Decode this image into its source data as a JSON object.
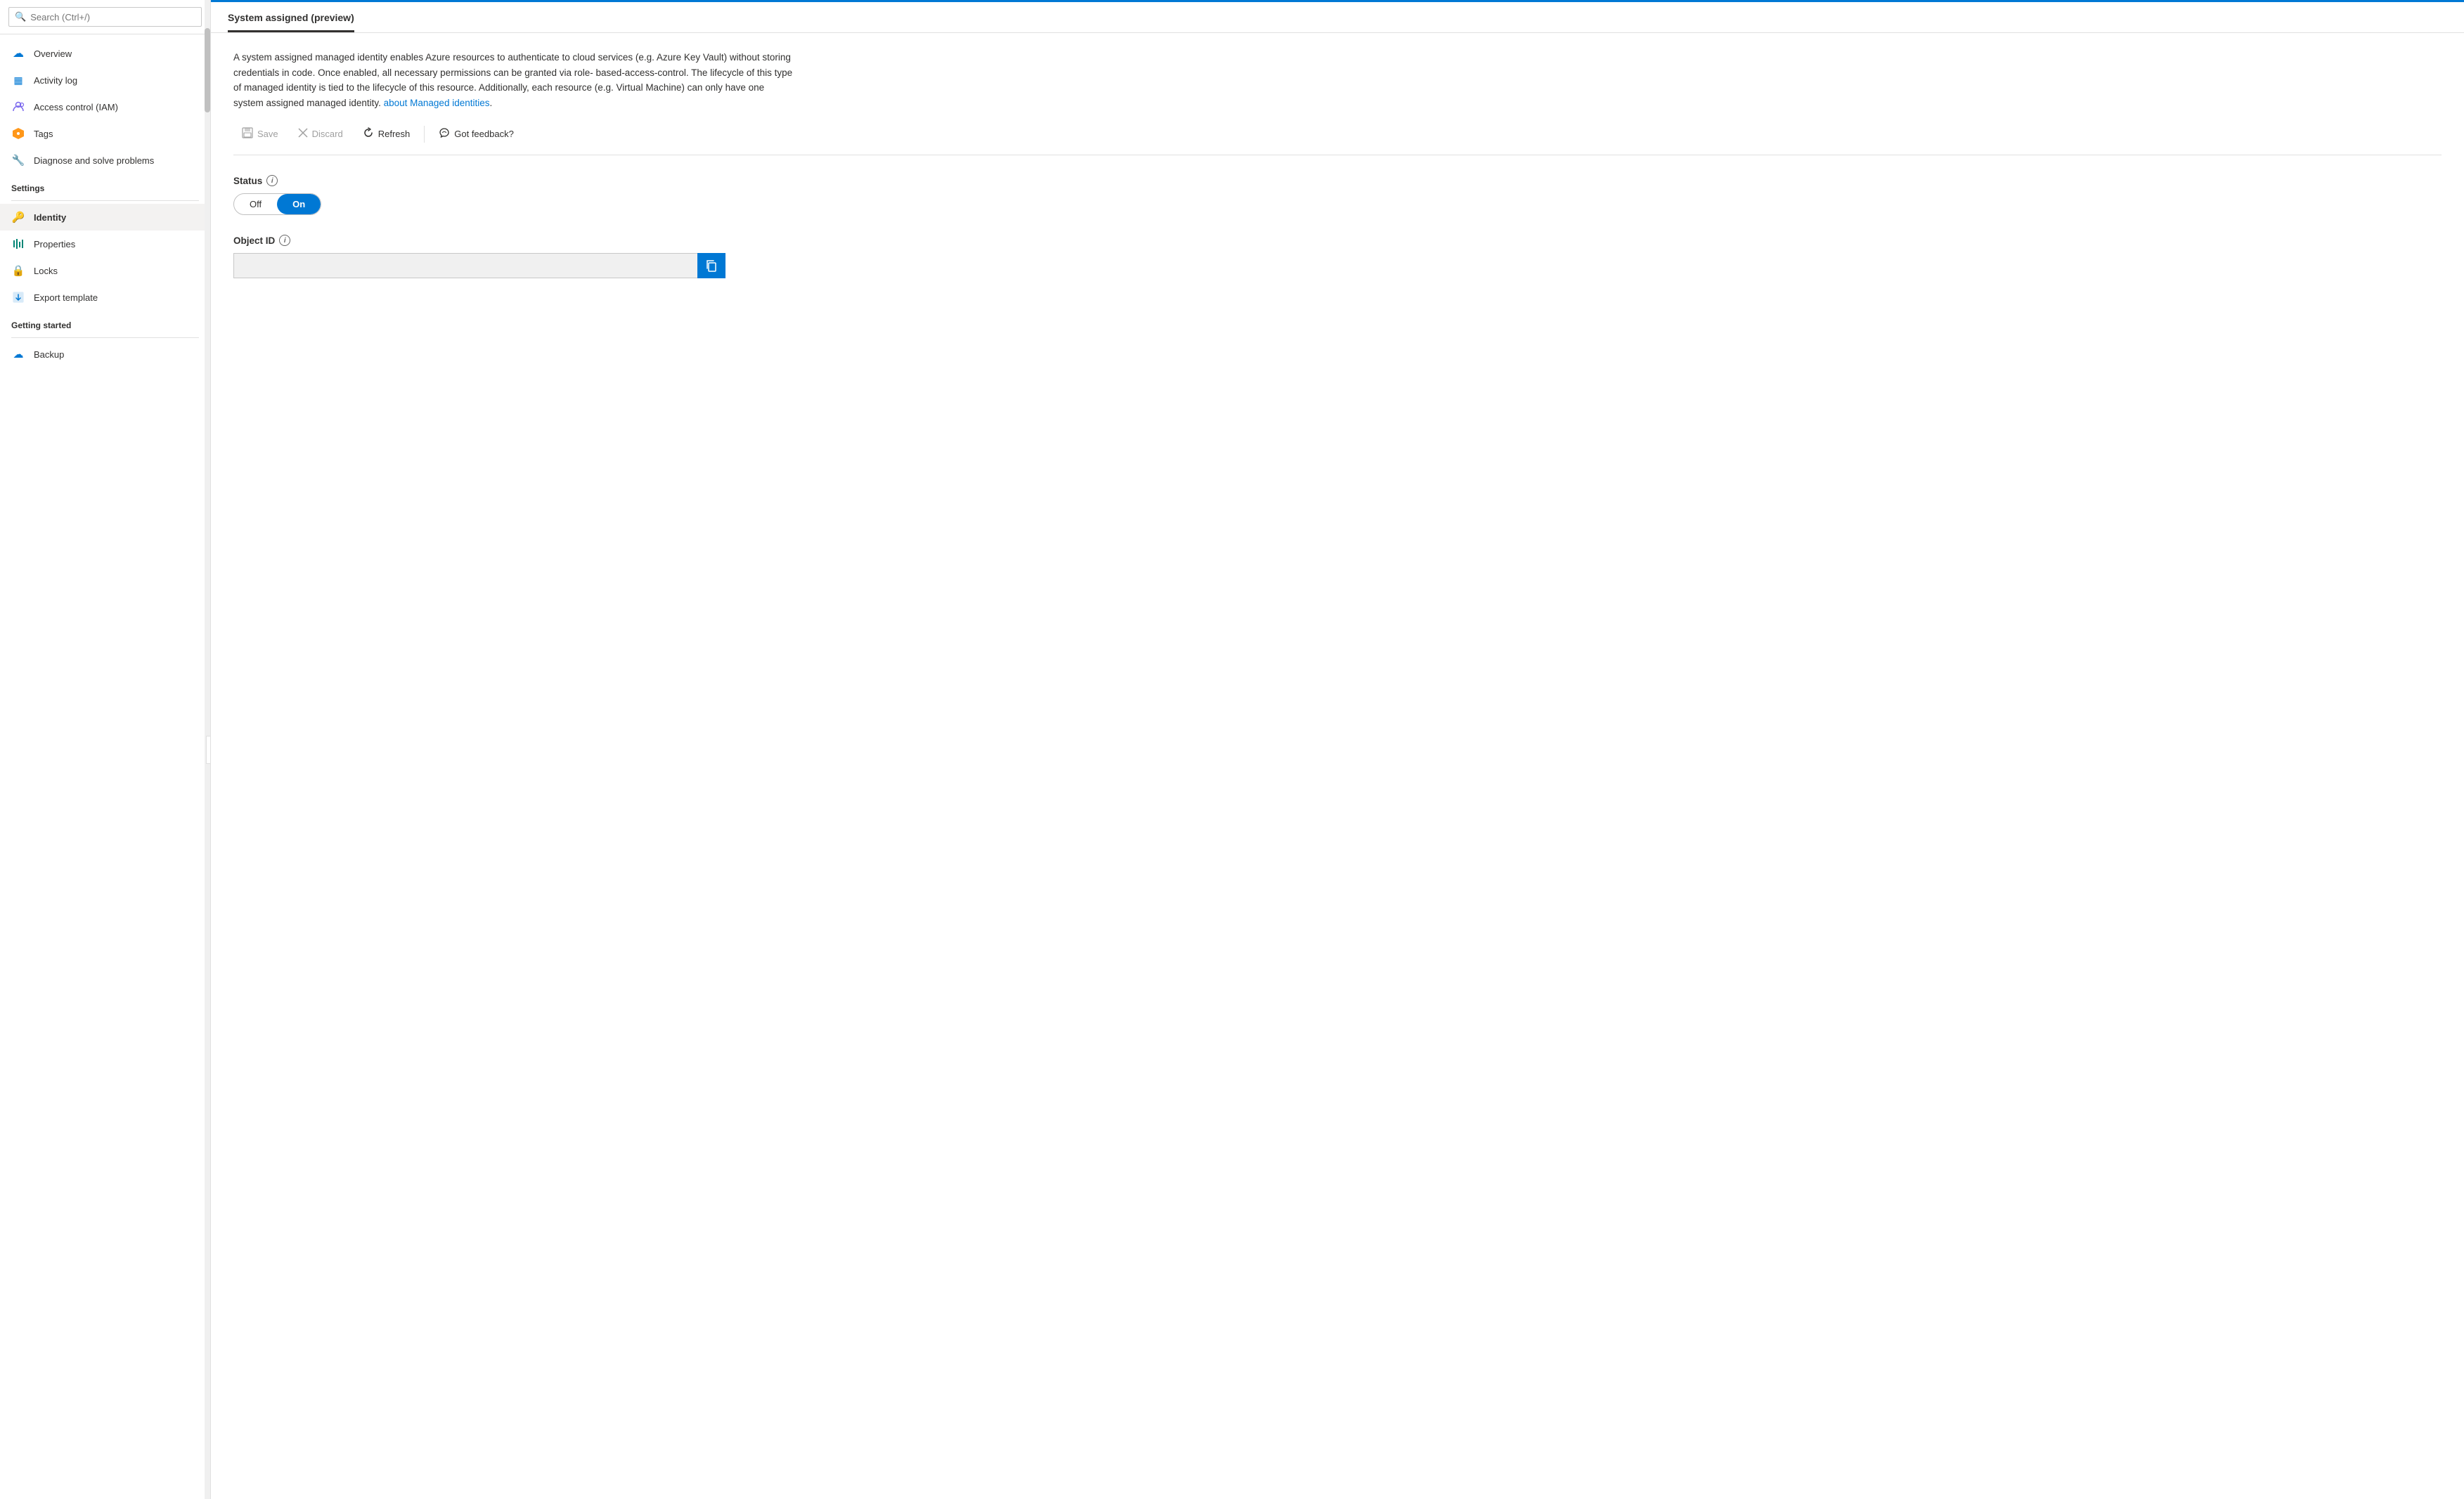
{
  "sidebar": {
    "search_placeholder": "Search (Ctrl+/)",
    "collapse_icon": "«",
    "items": [
      {
        "id": "overview",
        "label": "Overview",
        "icon": "☁",
        "icon_color": "icon-blue",
        "section": null,
        "active": false
      },
      {
        "id": "activity-log",
        "label": "Activity log",
        "icon": "▦",
        "icon_color": "icon-blue",
        "section": null,
        "active": false
      },
      {
        "id": "access-control",
        "label": "Access control (IAM)",
        "icon": "👤",
        "icon_color": "icon-purple",
        "section": null,
        "active": false
      },
      {
        "id": "tags",
        "label": "Tags",
        "icon": "⬡",
        "icon_color": "icon-multi",
        "section": null,
        "active": false
      },
      {
        "id": "diagnose",
        "label": "Diagnose and solve problems",
        "icon": "🔧",
        "icon_color": "icon-gray",
        "section": null,
        "active": false
      }
    ],
    "sections": [
      {
        "id": "settings",
        "label": "Settings",
        "items": [
          {
            "id": "identity",
            "label": "Identity",
            "icon": "🔑",
            "icon_color": "icon-yellow",
            "active": true
          },
          {
            "id": "properties",
            "label": "Properties",
            "icon": "≡",
            "icon_color": "icon-teal",
            "active": false
          },
          {
            "id": "locks",
            "label": "Locks",
            "icon": "🔒",
            "icon_color": "icon-blue",
            "active": false
          },
          {
            "id": "export-template",
            "label": "Export template",
            "icon": "⬇",
            "icon_color": "icon-blue",
            "active": false
          }
        ]
      },
      {
        "id": "getting-started",
        "label": "Getting started",
        "items": [
          {
            "id": "backup",
            "label": "Backup",
            "icon": "☁",
            "icon_color": "icon-blue",
            "active": false
          }
        ]
      }
    ]
  },
  "main": {
    "tab_label": "System assigned (preview)",
    "description": "A system assigned managed identity enables Azure resources to authenticate to cloud services (e.g. Azure Key Vault) without storing credentials in code. Once enabled, all necessary permissions can be granted via role-based-access-control. The lifecycle of this type of managed identity is tied to the lifecycle of this resource. Additionally, each resource (e.g. Virtual Machine) can only have one system assigned managed identity.",
    "description_link_text": "about Managed identities",
    "toolbar": {
      "save_label": "Save",
      "discard_label": "Discard",
      "refresh_label": "Refresh",
      "feedback_label": "Got feedback?"
    },
    "status_section": {
      "label": "Status",
      "toggle_off": "Off",
      "toggle_on": "On",
      "toggle_state": "on"
    },
    "object_id_section": {
      "label": "Object ID",
      "value": "",
      "placeholder": ""
    }
  }
}
